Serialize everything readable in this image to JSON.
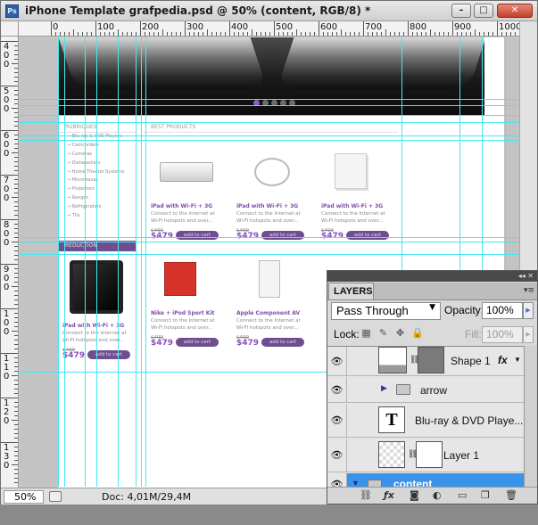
{
  "window": {
    "app_icon": "Ps",
    "title": "iPhone Template grafpedia.psd @ 50% (content, RGB/8) *",
    "buttons": [
      "minimize",
      "maximize",
      "close"
    ]
  },
  "ruler_top": [
    "0",
    "100",
    "200",
    "300",
    "400",
    "500",
    "600",
    "700",
    "800",
    "900",
    "1000"
  ],
  "ruler_left": [
    "4 0 0",
    "5 0 0",
    "6 0 0",
    "7 0 0",
    "8 0 0",
    "9 0 0",
    "1 0 0",
    "1 1 0",
    "1 2 0",
    "1 3 0"
  ],
  "website": {
    "rubriques_header": "RUBRIQUES",
    "best_header": "BEST PRODUCTS",
    "rubriques": [
      "Blu-ray & DVD Players",
      "Camcorders",
      "Cameras",
      "Dishwashers",
      "Home Theater Systems",
      "Microwaves",
      "Projectors",
      "Ranges",
      "Refrigerators",
      "TVs"
    ],
    "reduction_header": "REDUCTION",
    "products": [
      {
        "name": "iPad with Wi-Fi + 3G",
        "desc1": "Connect to the Internet at",
        "desc2": "Wi-Fi hotspots and over...",
        "old": "$499",
        "price": "$479",
        "button": "add to cart"
      },
      {
        "name": "iPad with Wi-Fi + 3G",
        "desc1": "Connect to the Internet at",
        "desc2": "Wi-Fi hotspots and over...",
        "old": "$499",
        "price": "$479",
        "button": "add to cart"
      },
      {
        "name": "iPad with Wi-Fi + 3G",
        "desc1": "Connect to the Internet at",
        "desc2": "Wi-Fi hotspots and over...",
        "old": "$499",
        "price": "$479",
        "button": "add to cart"
      },
      {
        "name": "iPad with Wi-Fi + 3G",
        "desc1": "Connect to the Internet at",
        "desc2": "Wi-Fi hotspots and over...",
        "old": "$499",
        "price": "$479",
        "button": "add to cart"
      },
      {
        "name": "Nike + iPod Sport Kit",
        "desc1": "Connect to the Internet at",
        "desc2": "Wi-Fi hotspots and over...",
        "old": "$499",
        "price": "$479",
        "button": "add to cart"
      },
      {
        "name": "Apple Component AV",
        "desc1": "Connect to the Internet at",
        "desc2": "Wi-Fi hotspots and over...",
        "old": "$499",
        "price": "$479",
        "button": "add to cart"
      }
    ]
  },
  "status": {
    "zoom": "50%",
    "doc_info": "Doc: 4,01M/29,4M"
  },
  "layers_panel": {
    "tab": "LAYERS",
    "blend_mode": "Pass Through",
    "opacity_label": "Opacity:",
    "opacity_value": "100%",
    "lock_label": "Lock:",
    "fill_label": "Fill:",
    "fill_value": "100%",
    "layers": [
      {
        "name": "Shape 1",
        "fx": "fx"
      },
      {
        "name": "arrow"
      },
      {
        "name": "Blu-ray & DVD Playe..."
      },
      {
        "name": "Layer 1"
      },
      {
        "name": "content"
      }
    ]
  },
  "colors": {
    "guide": "#45e8f0",
    "accent_purple": "#6e4e8e",
    "selection_blue": "#3a93ea"
  }
}
